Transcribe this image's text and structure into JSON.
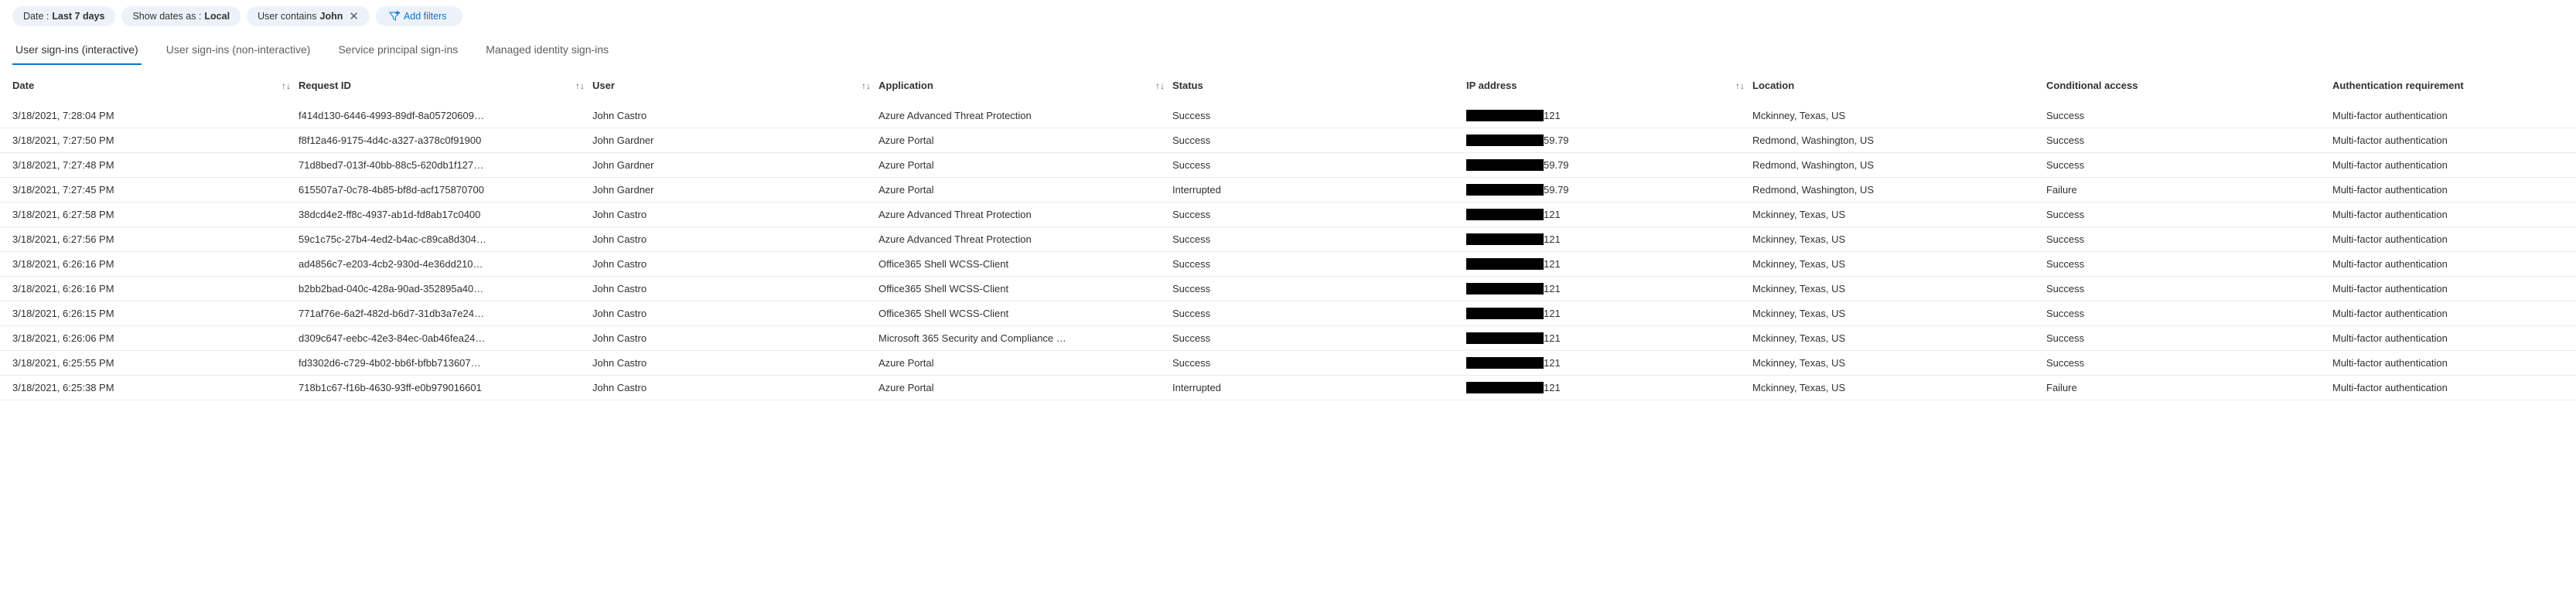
{
  "filters": {
    "date": {
      "label": "Date :",
      "value": "Last 7 days"
    },
    "show_dates_as": {
      "label": "Show dates as :",
      "value": "Local"
    },
    "user_contains": {
      "label": "User contains",
      "value": "John"
    },
    "add_filters_label": "Add filters"
  },
  "tabs": [
    {
      "label": "User sign-ins (interactive)",
      "active": true
    },
    {
      "label": "User sign-ins (non-interactive)",
      "active": false
    },
    {
      "label": "Service principal sign-ins",
      "active": false
    },
    {
      "label": "Managed identity sign-ins",
      "active": false
    }
  ],
  "columns": {
    "date": "Date",
    "request_id": "Request ID",
    "user": "User",
    "application": "Application",
    "status": "Status",
    "ip": "IP address",
    "location": "Location",
    "conditional_access": "Conditional access",
    "auth_req": "Authentication requirement"
  },
  "rows": [
    {
      "date": "3/18/2021, 7:28:04 PM",
      "request_id": "f414d130-6446-4993-89df-8a05720609…",
      "user": "John Castro",
      "application": "Azure Advanced Threat Protection",
      "status": "Success",
      "ip_suffix": "121",
      "location": "Mckinney, Texas, US",
      "conditional_access": "Success",
      "auth_req": "Multi-factor authentication"
    },
    {
      "date": "3/18/2021, 7:27:50 PM",
      "request_id": "f8f12a46-9175-4d4c-a327-a378c0f91900",
      "user": "John Gardner",
      "application": "Azure Portal",
      "status": "Success",
      "ip_suffix": "59.79",
      "location": "Redmond, Washington, US",
      "conditional_access": "Success",
      "auth_req": "Multi-factor authentication"
    },
    {
      "date": "3/18/2021, 7:27:48 PM",
      "request_id": "71d8bed7-013f-40bb-88c5-620db1f127…",
      "user": "John Gardner",
      "application": "Azure Portal",
      "status": "Success",
      "ip_suffix": "59.79",
      "location": "Redmond, Washington, US",
      "conditional_access": "Success",
      "auth_req": "Multi-factor authentication"
    },
    {
      "date": "3/18/2021, 7:27:45 PM",
      "request_id": "615507a7-0c78-4b85-bf8d-acf175870700",
      "user": "John Gardner",
      "application": "Azure Portal",
      "status": "Interrupted",
      "ip_suffix": "59.79",
      "location": "Redmond, Washington, US",
      "conditional_access": "Failure",
      "auth_req": "Multi-factor authentication"
    },
    {
      "date": "3/18/2021, 6:27:58 PM",
      "request_id": "38dcd4e2-ff8c-4937-ab1d-fd8ab17c0400",
      "user": "John Castro",
      "application": "Azure Advanced Threat Protection",
      "status": "Success",
      "ip_suffix": "121",
      "location": "Mckinney, Texas, US",
      "conditional_access": "Success",
      "auth_req": "Multi-factor authentication"
    },
    {
      "date": "3/18/2021, 6:27:56 PM",
      "request_id": "59c1c75c-27b4-4ed2-b4ac-c89ca8d304…",
      "user": "John Castro",
      "application": "Azure Advanced Threat Protection",
      "status": "Success",
      "ip_suffix": "121",
      "location": "Mckinney, Texas, US",
      "conditional_access": "Success",
      "auth_req": "Multi-factor authentication"
    },
    {
      "date": "3/18/2021, 6:26:16 PM",
      "request_id": "ad4856c7-e203-4cb2-930d-4e36dd210…",
      "user": "John Castro",
      "application": "Office365 Shell WCSS-Client",
      "status": "Success",
      "ip_suffix": "121",
      "location": "Mckinney, Texas, US",
      "conditional_access": "Success",
      "auth_req": "Multi-factor authentication"
    },
    {
      "date": "3/18/2021, 6:26:16 PM",
      "request_id": "b2bb2bad-040c-428a-90ad-352895a40…",
      "user": "John Castro",
      "application": "Office365 Shell WCSS-Client",
      "status": "Success",
      "ip_suffix": "121",
      "location": "Mckinney, Texas, US",
      "conditional_access": "Success",
      "auth_req": "Multi-factor authentication"
    },
    {
      "date": "3/18/2021, 6:26:15 PM",
      "request_id": "771af76e-6a2f-482d-b6d7-31db3a7e24…",
      "user": "John Castro",
      "application": "Office365 Shell WCSS-Client",
      "status": "Success",
      "ip_suffix": "121",
      "location": "Mckinney, Texas, US",
      "conditional_access": "Success",
      "auth_req": "Multi-factor authentication"
    },
    {
      "date": "3/18/2021, 6:26:06 PM",
      "request_id": "d309c647-eebc-42e3-84ec-0ab46fea24…",
      "user": "John Castro",
      "application": "Microsoft 365 Security and Compliance …",
      "status": "Success",
      "ip_suffix": "121",
      "location": "Mckinney, Texas, US",
      "conditional_access": "Success",
      "auth_req": "Multi-factor authentication"
    },
    {
      "date": "3/18/2021, 6:25:55 PM",
      "request_id": "fd3302d6-c729-4b02-bb6f-bfbb713607…",
      "user": "John Castro",
      "application": "Azure Portal",
      "status": "Success",
      "ip_suffix": "121",
      "location": "Mckinney, Texas, US",
      "conditional_access": "Success",
      "auth_req": "Multi-factor authentication"
    },
    {
      "date": "3/18/2021, 6:25:38 PM",
      "request_id": "718b1c67-f16b-4630-93ff-e0b979016601",
      "user": "John Castro",
      "application": "Azure Portal",
      "status": "Interrupted",
      "ip_suffix": "121",
      "location": "Mckinney, Texas, US",
      "conditional_access": "Failure",
      "auth_req": "Multi-factor authentication"
    }
  ]
}
